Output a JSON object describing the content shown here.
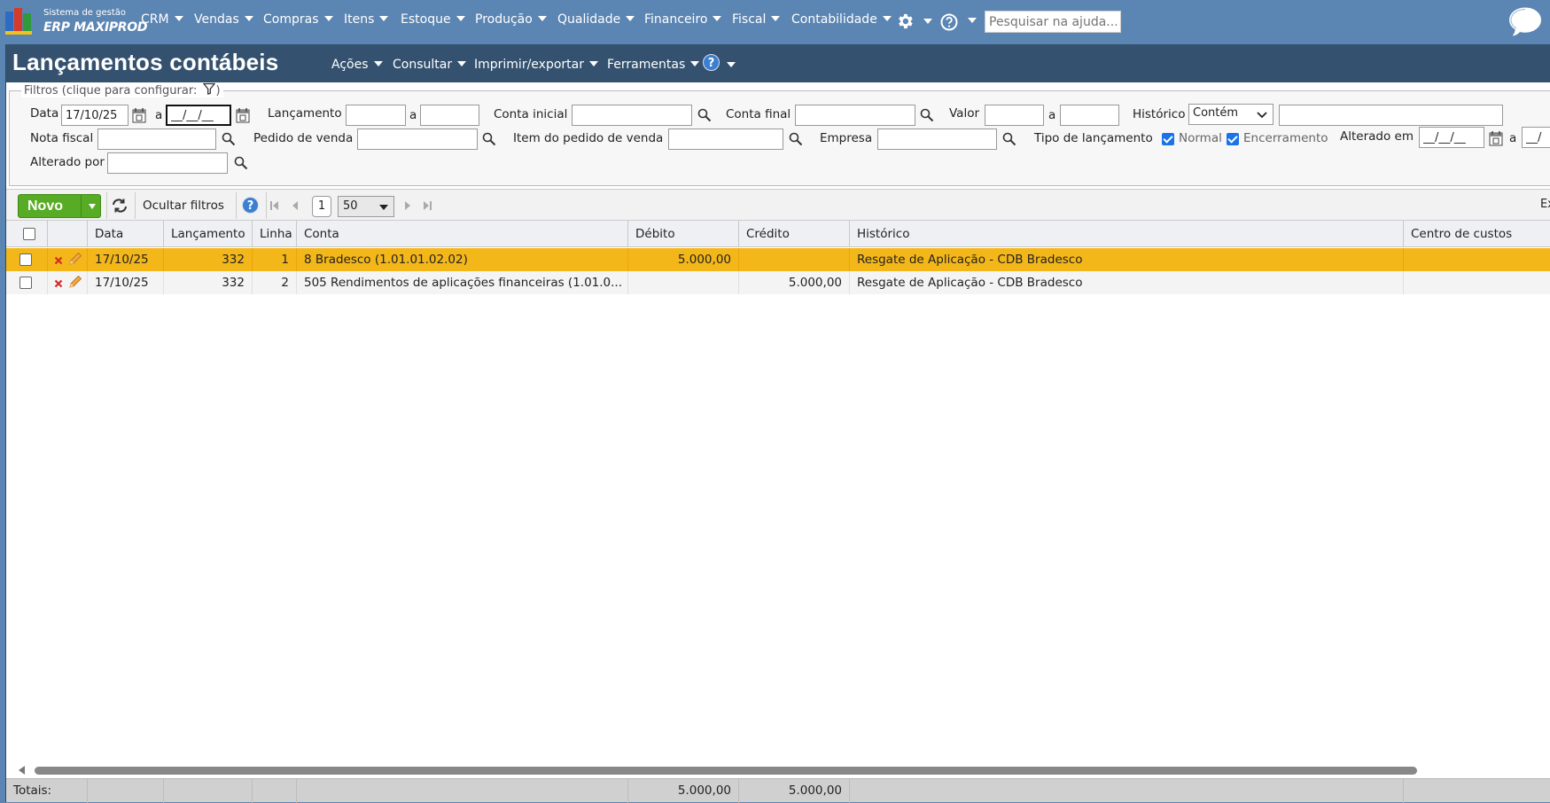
{
  "app": {
    "brand_line1": "Sistema de gestão",
    "brand_line2": "ERP MAXIPROD"
  },
  "topnav": {
    "items": [
      "CRM",
      "Vendas",
      "Compras",
      "Itens",
      "Estoque",
      "Produção",
      "Qualidade",
      "Financeiro",
      "Fiscal",
      "Contabilidade"
    ],
    "help_search_placeholder": "Pesquisar na ajuda..."
  },
  "titlebar": {
    "title": "Lançamentos contábeis",
    "menus": [
      "Ações",
      "Consultar",
      "Imprimir/exportar",
      "Ferramentas"
    ],
    "help_glyph": "?"
  },
  "filters": {
    "legend": "Filtros (clique para configurar:",
    "legend_close": ")",
    "range_sep": "a",
    "data_label": "Data",
    "data_from": "17/10/25",
    "data_to": "__/__/__",
    "lancamento_label": "Lançamento",
    "conta_inicial_label": "Conta inicial",
    "conta_final_label": "Conta final",
    "valor_label": "Valor",
    "historico_label": "Histórico",
    "historico_op": "Contém",
    "nota_fiscal_label": "Nota fiscal",
    "pedido_venda_label": "Pedido de venda",
    "item_pedido_label": "Item do pedido de venda",
    "empresa_label": "Empresa",
    "tipo_label": "Tipo de lançamento",
    "tipo_normal": "Normal",
    "tipo_encerramento": "Encerramento",
    "alterado_em_label": "Alterado em",
    "alterado_em_from": "__/__/__",
    "alterado_em_to": "__/",
    "alterado_por_label": "Alterado por"
  },
  "toolbar": {
    "novo_label": "Novo",
    "ocultar_filtros_label": "Ocultar filtros",
    "help_glyph": "?",
    "page": "1",
    "per_page": "50",
    "right_cut": "Ex"
  },
  "grid": {
    "columns": [
      "Data",
      "Lançamento",
      "Linha",
      "Conta",
      "Débito",
      "Crédito",
      "Histórico",
      "Centro de custos"
    ],
    "rows": [
      {
        "data": "17/10/25",
        "lancamento": "332",
        "linha": "1",
        "conta": "8 Bradesco (1.01.01.02.02)",
        "debito": "5.000,00",
        "credito": "",
        "historico": "Resgate de Aplicação - CDB Bradesco",
        "centro": ""
      },
      {
        "data": "17/10/25",
        "lancamento": "332",
        "linha": "2",
        "conta": "505 Rendimentos de aplicações financeiras (1.01.0...",
        "debito": "",
        "credito": "5.000,00",
        "historico": "Resgate de Aplicação - CDB Bradesco",
        "centro": ""
      }
    ],
    "totals_label": "Totais:",
    "total_debito": "5.000,00",
    "total_credito": "5.000,00"
  },
  "colors": {
    "nav_bg": "#5b85b3",
    "title_bg": "#34526f",
    "selected_row": "#f4b719",
    "novo_green": "#58ab25"
  }
}
